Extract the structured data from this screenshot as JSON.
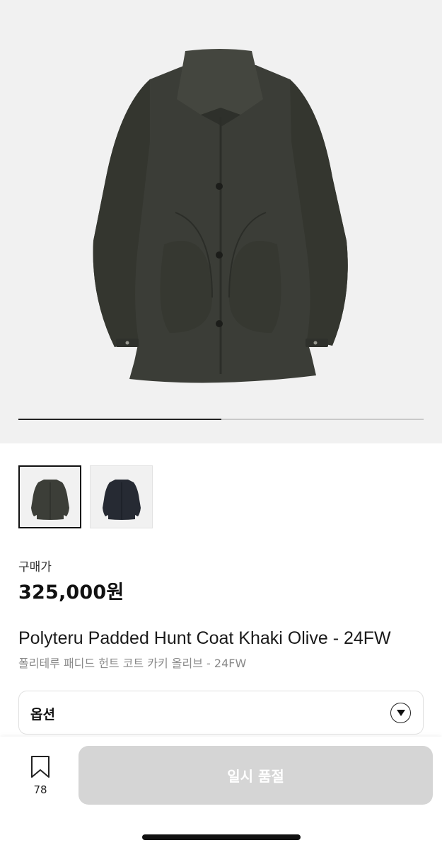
{
  "product": {
    "images": [
      {
        "name": "coat-khaki-olive",
        "color": "#3c3e38"
      },
      {
        "name": "coat-navy",
        "color": "#262a33"
      }
    ],
    "image_progress": 0.5,
    "price_label": "구매가",
    "price": "325,000원",
    "title_en": "Polyteru Padded Hunt Coat Khaki Olive - 24FW",
    "title_ko": "폴리테루 패디드 헌트 코트 카키 올리브 - 24FW"
  },
  "option": {
    "label": "옵션",
    "icon": "chevron-down-icon"
  },
  "bottom_bar": {
    "bookmark_icon": "bookmark-icon",
    "bookmark_count": "78",
    "cta_label": "일시 품절",
    "cta_color": "#d5d5d5"
  }
}
